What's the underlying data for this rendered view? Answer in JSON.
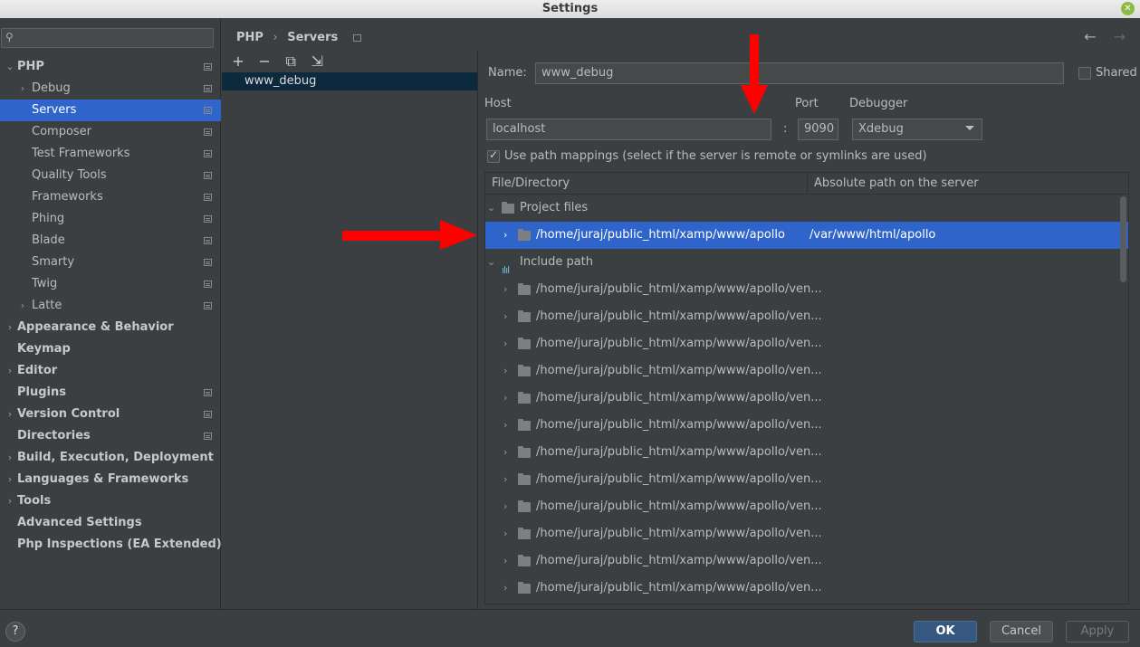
{
  "window": {
    "title": "Settings"
  },
  "search": {
    "placeholder": "",
    "icon": "search-icon"
  },
  "tree": {
    "items": [
      {
        "label": "PHP",
        "level": 0,
        "arrow": "⌄"
      },
      {
        "label": "Debug",
        "level": 1,
        "arrow": "›"
      },
      {
        "label": "Servers",
        "level": 1,
        "selected": true
      },
      {
        "label": "Composer",
        "level": 1
      },
      {
        "label": "Test Frameworks",
        "level": 1
      },
      {
        "label": "Quality Tools",
        "level": 1
      },
      {
        "label": "Frameworks",
        "level": 1
      },
      {
        "label": "Phing",
        "level": 1
      },
      {
        "label": "Blade",
        "level": 1
      },
      {
        "label": "Smarty",
        "level": 1
      },
      {
        "label": "Twig",
        "level": 1
      },
      {
        "label": "Latte",
        "level": 1,
        "arrow": "›"
      },
      {
        "label": "Appearance & Behavior",
        "level": 0,
        "arrow": "›"
      },
      {
        "label": "Keymap",
        "level": 0
      },
      {
        "label": "Editor",
        "level": 0,
        "arrow": "›"
      },
      {
        "label": "Plugins",
        "level": 0
      },
      {
        "label": "Version Control",
        "level": 0,
        "arrow": "›"
      },
      {
        "label": "Directories",
        "level": 0
      },
      {
        "label": "Build, Execution, Deployment",
        "level": 0,
        "arrow": "›"
      },
      {
        "label": "Languages & Frameworks",
        "level": 0,
        "arrow": "›"
      },
      {
        "label": "Tools",
        "level": 0,
        "arrow": "›"
      },
      {
        "label": "Advanced Settings",
        "level": 0
      },
      {
        "label": "Php Inspections (EA Extended)",
        "level": 0
      }
    ]
  },
  "breadcrumb": {
    "part1": "PHP",
    "sep": "›",
    "part2": "Servers"
  },
  "nav": {
    "back": "←",
    "forward": "→"
  },
  "servers": {
    "toolbar": {
      "add": "+",
      "remove": "−",
      "copy": "⧉",
      "import": "⇲"
    },
    "items": [
      "www_debug"
    ]
  },
  "form": {
    "name_label": "Name:",
    "name_value": "www_debug",
    "shared_label": "Shared",
    "host_label": "Host",
    "host_value": "localhost",
    "port_label": "Port",
    "port_value": "9090",
    "colon": ":",
    "debugger_label": "Debugger",
    "debugger_value": "Xdebug",
    "path_mappings_label": "Use path mappings (select if the server is remote or symlinks are used)"
  },
  "table": {
    "col1": "File/Directory",
    "col2": "Absolute path on the server",
    "rows": [
      {
        "kind": "group",
        "label": "Project files",
        "icon": "folder-icon"
      },
      {
        "kind": "item",
        "label": "/home/juraj/public_html/xamp/www/apollo",
        "server": "/var/www/html/apollo",
        "selected": true
      },
      {
        "kind": "group",
        "label": "Include path",
        "icon": "library-icon"
      },
      {
        "kind": "item",
        "label": "/home/juraj/public_html/xamp/www/apollo/ven..."
      },
      {
        "kind": "item",
        "label": "/home/juraj/public_html/xamp/www/apollo/ven..."
      },
      {
        "kind": "item",
        "label": "/home/juraj/public_html/xamp/www/apollo/ven..."
      },
      {
        "kind": "item",
        "label": "/home/juraj/public_html/xamp/www/apollo/ven..."
      },
      {
        "kind": "item",
        "label": "/home/juraj/public_html/xamp/www/apollo/ven..."
      },
      {
        "kind": "item",
        "label": "/home/juraj/public_html/xamp/www/apollo/ven..."
      },
      {
        "kind": "item",
        "label": "/home/juraj/public_html/xamp/www/apollo/ven..."
      },
      {
        "kind": "item",
        "label": "/home/juraj/public_html/xamp/www/apollo/ven..."
      },
      {
        "kind": "item",
        "label": "/home/juraj/public_html/xamp/www/apollo/ven..."
      },
      {
        "kind": "item",
        "label": "/home/juraj/public_html/xamp/www/apollo/ven..."
      },
      {
        "kind": "item",
        "label": "/home/juraj/public_html/xamp/www/apollo/ven..."
      },
      {
        "kind": "item",
        "label": "/home/juraj/public_html/xamp/www/apollo/ven..."
      }
    ]
  },
  "buttons": {
    "help": "?",
    "ok": "OK",
    "cancel": "Cancel",
    "apply": "Apply"
  },
  "colors": {
    "selection": "#2f65ca",
    "background": "#3c3f41",
    "annotation": "#ff0000"
  }
}
